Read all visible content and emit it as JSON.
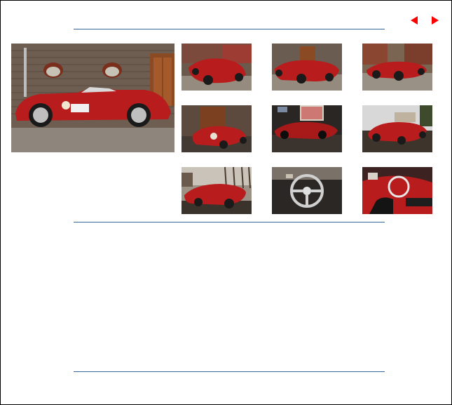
{
  "navigation": {
    "previous_icon": "left-triangle-arrow-icon",
    "next_icon": "right-triangle-arrow-icon",
    "arrow_color": "#ff0000"
  },
  "colors": {
    "rule": "#336699",
    "car_red": "#b81c1c"
  },
  "main_image": {
    "icon": "red-classic-sports-car-side-view-photo"
  },
  "thumbnails": [
    {
      "icon": "car-front-three-quarter-photo"
    },
    {
      "icon": "car-rear-three-quarter-photo"
    },
    {
      "icon": "car-rear-view-photo"
    },
    {
      "icon": "car-front-view-photo"
    },
    {
      "icon": "car-in-garage-photo"
    },
    {
      "icon": "car-outdoor-front-photo"
    },
    {
      "icon": "car-rear-outdoor-photo"
    },
    {
      "icon": "steering-wheel-cockpit-photo"
    },
    {
      "icon": "cockpit-detail-photo"
    }
  ]
}
